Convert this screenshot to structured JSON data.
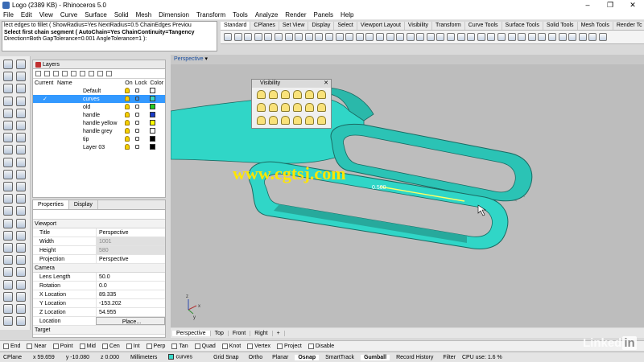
{
  "window": {
    "title": "Logo (2389 KB) - Rhinoceros 5.0",
    "controls": [
      "–",
      "❐",
      "✕"
    ]
  },
  "menu": [
    "File",
    "Edit",
    "View",
    "Curve",
    "Surface",
    "Solid",
    "Mesh",
    "Dimension",
    "Transform",
    "Tools",
    "Analyze",
    "Render",
    "Panels",
    "Help"
  ],
  "command": {
    "line1": "lect edges to fillet ( ShowRadius=Yes  NextRadius=0.5  ChainEdges  Previou",
    "line2": "Select first chain segment ( AutoChain=Yes  ChainContinuity=Tangency",
    "line3": "Direction=Both  GapTolerance=0.001  AngleTolerance=1 ):"
  },
  "toolbar_tabs": [
    "Standard",
    "CPlanes",
    "Set View",
    "Display",
    "Select",
    "Viewport Layout",
    "Visibility",
    "Transform",
    "Curve Tools",
    "Surface Tools",
    "Solid Tools",
    "Mesh Tools",
    "Render Tc"
  ],
  "layers": {
    "tab": "Layers",
    "headers": {
      "current": "Current",
      "name": "Name",
      "on": "On",
      "lock": "Lock",
      "color": "Color"
    },
    "rows": [
      {
        "name": "Default",
        "color": "#ffffff",
        "current": "",
        "selected": false
      },
      {
        "name": "curves",
        "color": "#3ad9c8",
        "current": "✓",
        "selected": true
      },
      {
        "name": "old",
        "color": "#22cc22",
        "current": "",
        "selected": false
      },
      {
        "name": "handle",
        "color": "#1a3cc8",
        "current": "",
        "selected": false
      },
      {
        "name": "handle yellow",
        "color": "#ffff00",
        "current": "",
        "selected": false
      },
      {
        "name": "handle grey",
        "color": "#ffffff",
        "current": "",
        "selected": false
      },
      {
        "name": "tip",
        "color": "#000000",
        "current": "",
        "selected": false
      },
      {
        "name": "Layer 03",
        "color": "#000000",
        "current": "",
        "selected": false
      }
    ]
  },
  "properties": {
    "tabs": [
      "Properties",
      "Display"
    ],
    "viewport_section": "Viewport",
    "viewport_rows": [
      {
        "key": "Title",
        "value": "Perspective",
        "disabled": false
      },
      {
        "key": "Width",
        "value": "1001",
        "disabled": true
      },
      {
        "key": "Height",
        "value": "580",
        "disabled": true
      },
      {
        "key": "Projection",
        "value": "Perspective",
        "disabled": false
      }
    ],
    "camera_section": "Camera",
    "camera_rows": [
      {
        "key": "Lens Length",
        "value": "50.0"
      },
      {
        "key": "Rotation",
        "value": "0.0"
      },
      {
        "key": "X Location",
        "value": "89.335"
      },
      {
        "key": "Y Location",
        "value": "-153.202"
      },
      {
        "key": "Z Location",
        "value": "54.955"
      }
    ],
    "location_key": "Location",
    "place_button": "Place...",
    "target_section": "Target"
  },
  "viewport": {
    "name": "Perspective",
    "dimension_label": "0.500",
    "axis_x": "x",
    "axis_y": "y",
    "axis_z": "z"
  },
  "visibility_toolbar": {
    "title": "Visibility",
    "close": "✕"
  },
  "viewport_tabs": [
    "Perspective",
    "Top",
    "Front",
    "Right",
    "+"
  ],
  "osnaps": [
    {
      "label": "End",
      "checked": false
    },
    {
      "label": "Near",
      "checked": false
    },
    {
      "label": "Point",
      "checked": false
    },
    {
      "label": "Mid",
      "checked": false
    },
    {
      "label": "Cen",
      "checked": false
    },
    {
      "label": "Int",
      "checked": false
    },
    {
      "label": "Perp",
      "checked": false
    },
    {
      "label": "Tan",
      "checked": false
    },
    {
      "label": "Quad",
      "checked": false
    },
    {
      "label": "Knot",
      "checked": false
    },
    {
      "label": "Vertex",
      "checked": false
    },
    {
      "label": "Project",
      "checked": false
    },
    {
      "label": "Disable",
      "checked": false
    }
  ],
  "status": {
    "cplane": "CPlane",
    "x": "x 59.659",
    "y": "y -10.080",
    "z": "z 0.000",
    "units": "Millimeters",
    "layer": "curves",
    "toggles": [
      {
        "label": "Grid Snap",
        "on": false
      },
      {
        "label": "Ortho",
        "on": false
      },
      {
        "label": "Planar",
        "on": false
      },
      {
        "label": "Osnap",
        "on": true
      },
      {
        "label": "SmartTrack",
        "on": false
      },
      {
        "label": "Gumball",
        "on": true
      },
      {
        "label": "Record History",
        "on": false
      },
      {
        "label": "Filter",
        "on": false
      }
    ],
    "cpu": "CPU use: 1.6 %"
  },
  "watermark": "www.cgtsj.com",
  "brand": "Linked"
}
